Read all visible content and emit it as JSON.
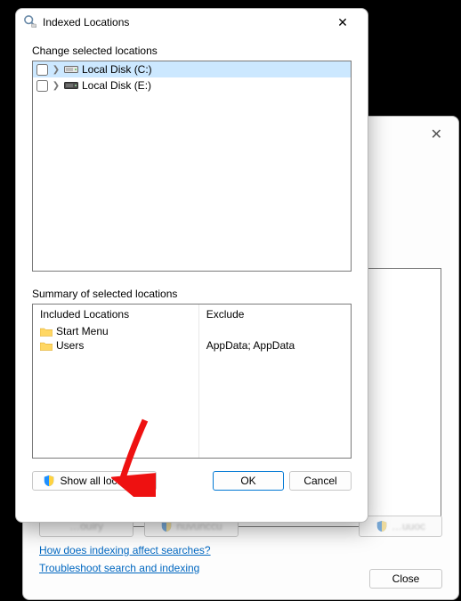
{
  "parent": {
    "close_x": "✕",
    "ghost1": "…ouiry",
    "ghost2": "nuvunccu",
    "ghost3": "…uuoc",
    "link1": "How does indexing affect searches?",
    "link2": "Troubleshoot search and indexing",
    "close_btn": "Close"
  },
  "dialog": {
    "title": "Indexed Locations",
    "close_x": "✕",
    "change_label": "Change selected locations",
    "tree": [
      {
        "label": "Local Disk (C:)",
        "selected": true
      },
      {
        "label": "Local Disk (E:)",
        "selected": false
      }
    ],
    "summary_label": "Summary of selected locations",
    "included_header": "Included Locations",
    "exclude_header": "Exclude",
    "included": [
      {
        "name": "Start Menu",
        "exclude": ""
      },
      {
        "name": "Users",
        "exclude": "AppData; AppData"
      }
    ],
    "buttons": {
      "show_all": "Show all locations",
      "ok": "OK",
      "cancel": "Cancel"
    }
  }
}
